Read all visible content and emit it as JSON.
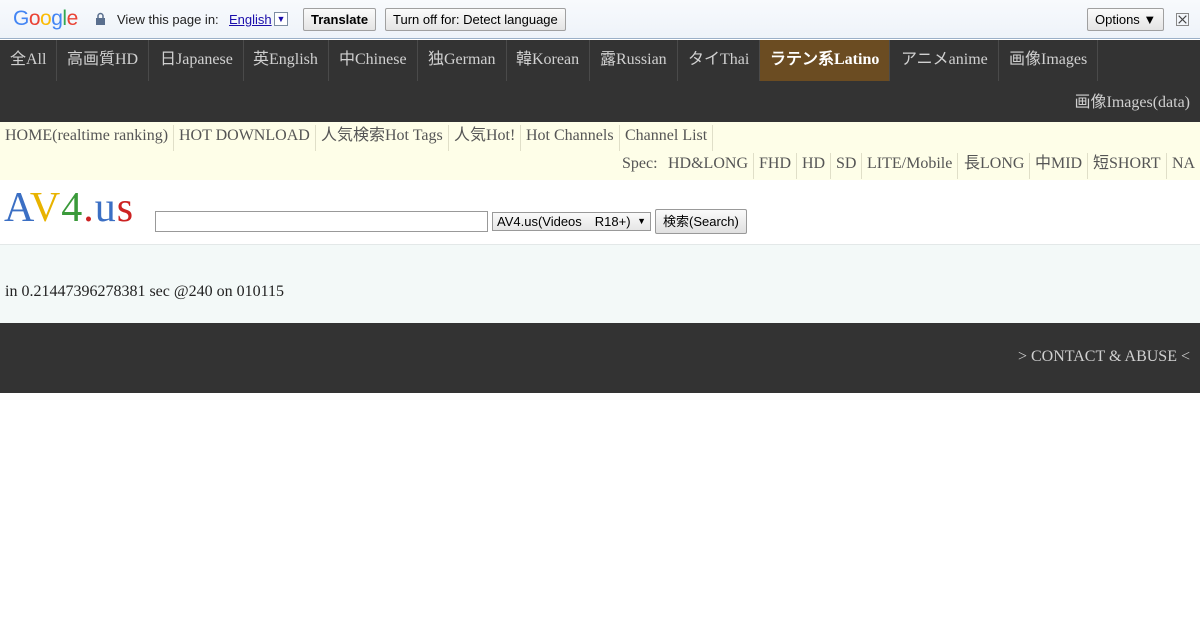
{
  "translate_bar": {
    "logo": "Google",
    "view_text": "View this page in:",
    "language": "English",
    "translate_label": "Translate",
    "turn_off_label": "Turn off for: Detect language",
    "options_label": "Options ▼"
  },
  "nav": {
    "items": [
      {
        "label": "全All"
      },
      {
        "label": "高画質HD"
      },
      {
        "label": "日Japanese"
      },
      {
        "label": "英English"
      },
      {
        "label": "中Chinese"
      },
      {
        "label": "独German"
      },
      {
        "label": "韓Korean"
      },
      {
        "label": "露Russian"
      },
      {
        "label": "タイThai"
      },
      {
        "label": "ラテン系Latino",
        "active": true
      },
      {
        "label": "アニメanime"
      },
      {
        "label": "画像Images"
      }
    ],
    "second_row": "画像Images(data)"
  },
  "subnav": {
    "items": [
      "HOME(realtime ranking)",
      "HOT DOWNLOAD",
      "人気検索Hot Tags",
      "人気Hot!",
      "Hot Channels",
      "Channel List"
    ],
    "spec_label": "Spec:",
    "spec_items": [
      "HD&LONG",
      "FHD",
      "HD",
      "SD",
      "LITE/Mobile",
      "長LONG",
      "中MID",
      "短SHORT",
      "NA"
    ]
  },
  "search": {
    "logo": "AV4.us",
    "input_value": "",
    "select_value": "AV4.us(Videos　R18+)",
    "button_label": "検索(Search)"
  },
  "info": {
    "timing_text": "in 0.21447396278381 sec @240 on 010115"
  },
  "footer": {
    "link": "> CONTACT & ABUSE <"
  }
}
